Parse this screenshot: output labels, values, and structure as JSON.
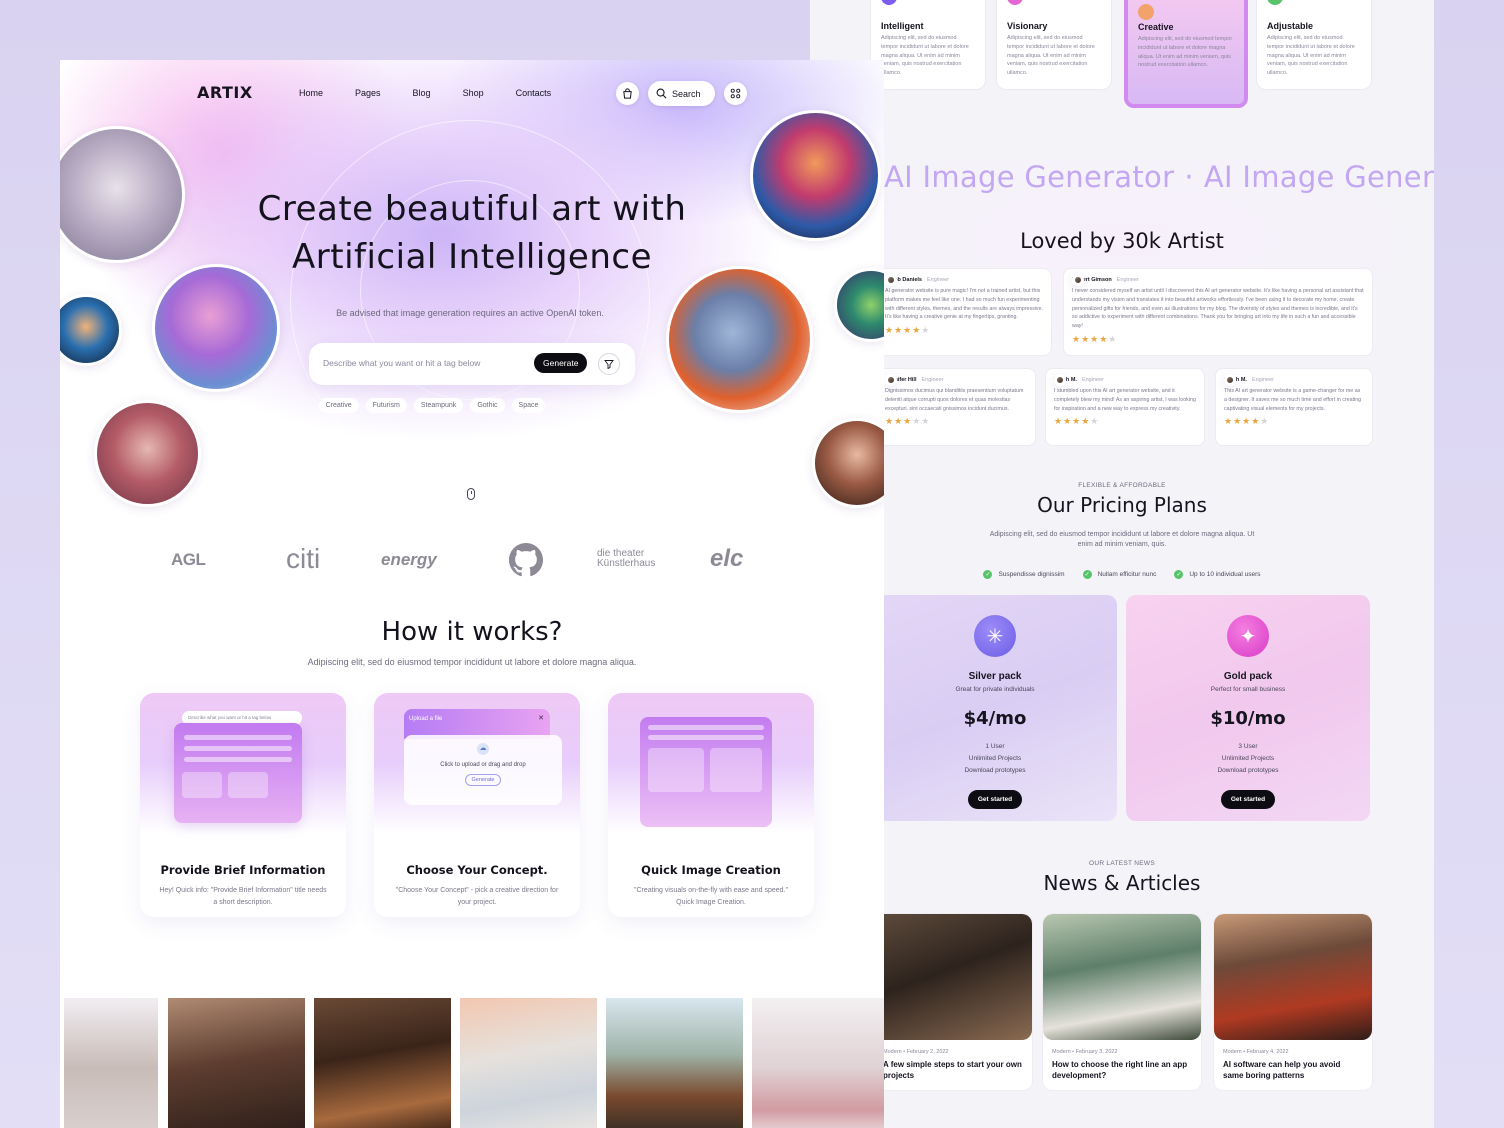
{
  "brand": {
    "name": "ARTIX"
  },
  "nav": {
    "items": [
      "Home",
      "Pages",
      "Blog",
      "Shop",
      "Contacts"
    ],
    "search_label": "Search"
  },
  "hero": {
    "title_line1": "Create beautiful art with",
    "title_line2": "Artificial Intelligence",
    "note": "Be advised that image generation requires an active OpenAI token.",
    "prompt_placeholder": "Describe what you want or hit a tag below",
    "generate_label": "Generate",
    "tags": [
      "Creative",
      "Futurism",
      "Steampunk",
      "Gothic",
      "Space"
    ]
  },
  "partners": [
    "AGL",
    "citi",
    "energy",
    "GitHub",
    "die theater Künstlerhaus",
    "elc"
  ],
  "how": {
    "title": "How it works?",
    "subtitle": "Adipiscing elit, sed do eiusmod tempor incididunt ut labore et dolore magna aliqua.",
    "mock_prompt": "Describe what you want or hit a tag below",
    "upload_title": "Upload a file",
    "upload_hint": "Click to upload or drag and drop",
    "upload_button": "Generate",
    "steps": [
      {
        "title": "Provide Brief Information",
        "text": "Hey! Quick info: \"Provide Brief Information\" title needs a short description."
      },
      {
        "title": "Choose Your Concept.",
        "text": "\"Choose Your Concept\" - pick a creative direction for your project."
      },
      {
        "title": "Quick Image Creation",
        "text": "\"Creating visuals on-the-fly with ease and speed.\" Quick Image Creation."
      }
    ]
  },
  "features": [
    {
      "title": "Intelligent",
      "text": "Adipiscing elit, sed do eiusmod tempor incididunt ut labore et dolore magna aliqua. Ut enim ad minim veniam, quis nostrud exercitation ullamco.",
      "color": "#7d5cf0"
    },
    {
      "title": "Visionary",
      "text": "Adipiscing elit, sed do eiusmod tempor incididunt ut labore et dolore magna aliqua. Ut enim ad minim veniam, quis nostrud exercitation ullamco.",
      "color": "#e368d6"
    },
    {
      "title": "Creative",
      "text": "Adipiscing elit, sed do eiusmod tempor incididunt ut labore et dolore magna aliqua. Ut enim ad minim veniam, quis nostrud exercitation ullamco.",
      "color": "#f2a36c"
    },
    {
      "title": "Adjustable",
      "text": "Adipiscing elit, sed do eiusmod tempor incididunt ut labore et dolore magna aliqua. Ut enim ad minim veniam, quis nostrud exercitation ullamco.",
      "color": "#58c46a"
    }
  ],
  "marquee": {
    "text": "AI Image Generator"
  },
  "testimonials": {
    "title": "Loved by 30k Artist",
    "items": [
      {
        "name": "Jacob Daniels",
        "role": "Engineer",
        "text": "AI generator website is pure magic! I'm not a trained artist, but this platform makes me feel like one. I had so much fun experimenting with different styles, themes, and the results are always impressive. It's like having a creative genie at my fingertips, granting.",
        "rating": 4
      },
      {
        "name": "Robert Gimson",
        "role": "Engineer",
        "text": "I never considered myself an artist until I discovered this AI art generator website. It's like having a personal art assistant that understands my vision and translates it into beautiful artworks effortlessly. I've been using it to decorate my home, create personalized gifts for friends, and even as illustrations for my blog. The diversity of styles and themes is incredible, and it's so addictive to experiment with different combinations. Thank you for bringing art into my life in such a fun and accessible way!",
        "rating": 4
      },
      {
        "name": "Jennifer Hill",
        "role": "Engineer",
        "text": "Dignissimos ducimus qui blanditiis praesentium voluptatum deleniti atque corrupti quos dolores et quas molestias excepturi. sint occaecati gnissimos incidunt ducimus.",
        "rating": 3
      },
      {
        "name": "Sarah M.",
        "role": "Engineer",
        "text": "I stumbled upon this AI art generator website, and it completely blew my mind! As an aspiring artist, I was looking for inspiration and a new way to express my creativity.",
        "rating": 4
      },
      {
        "name": "Sarah M.",
        "role": "Engineer",
        "text": "This AI art generator website is a game-changer for me as a designer. It saves me so much time and effort in creating captivating visual elements for my projects.",
        "rating": 4
      }
    ]
  },
  "pricing": {
    "kicker": "FLEXIBLE & AFFORDABLE",
    "title": "Our Pricing Plans",
    "subtitle": "Adipiscing elit, sed do eiusmod tempor incididunt ut labore et dolore magna aliqua. Ut enim ad minim veniam, quis.",
    "checks": [
      "Suspendisse dignissim",
      "Nullam efficitur nunc",
      "Up to 10 individual users"
    ],
    "plans": [
      {
        "name": "Silver pack",
        "desc": "Great for private individuals",
        "price": "$4/mo",
        "users": "1 User",
        "projects": "Unlimited Projects",
        "download": "Download prototypes",
        "cta": "Get started"
      },
      {
        "name": "Gold pack",
        "desc": "Perfect for small business",
        "price": "$10/mo",
        "users": "3 User",
        "projects": "Unlimited Projects",
        "download": "Download prototypes",
        "cta": "Get started"
      }
    ]
  },
  "news": {
    "kicker": "OUR LATEST NEWS",
    "title": "News & Articles",
    "items": [
      {
        "category": "Modern",
        "date": "February 2, 2022",
        "title": "A few simple steps to start your own projects"
      },
      {
        "category": "Modern",
        "date": "February 3, 2022",
        "title": "How to choose the right line an app development?"
      },
      {
        "category": "Modern",
        "date": "February 4, 2022",
        "title": "AI software can help you avoid same boring patterns"
      }
    ]
  }
}
